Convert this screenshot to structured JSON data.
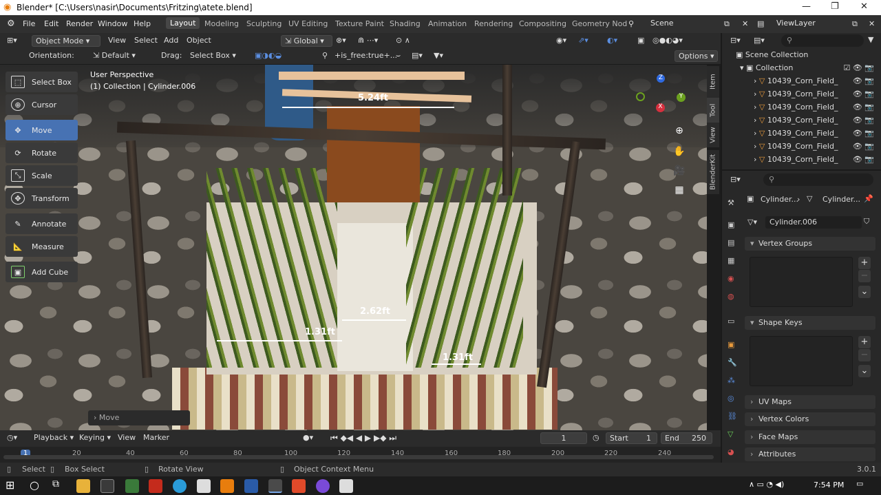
{
  "window": {
    "title": "Blender* [C:\\Users\\nasir\\Documents\\Fritzing\\atete.blend]",
    "min": "—",
    "max": "❐",
    "close": "✕"
  },
  "menu": {
    "file": "File",
    "edit": "Edit",
    "render": "Render",
    "window": "Window",
    "help": "Help"
  },
  "workspaces": [
    "Layout",
    "Modeling",
    "Sculpting",
    "UV Editing",
    "Texture Paint",
    "Shading",
    "Animation",
    "Rendering",
    "Compositing",
    "Geometry Nod"
  ],
  "scene": "Scene",
  "view_layer": "ViewLayer",
  "header": {
    "mode": "Object Mode",
    "view": "View",
    "select": "Select",
    "add": "Add",
    "object": "Object",
    "transform_orientation": "Global",
    "orientation_label": "Orientation:",
    "orientation_value": "Default",
    "drag_label": "Drag:",
    "drag_value": "Select Box",
    "filter": "+is_free:true+...",
    "options": "Options"
  },
  "viewport": {
    "perspective": "User Perspective",
    "collection_info": "(1) Collection | Cylinder.006",
    "last_op": "Move",
    "dims": [
      "5.24ft",
      "2.62ft",
      "1.31ft",
      "1.31ft"
    ]
  },
  "tools": [
    "Select Box",
    "Cursor",
    "Move",
    "Rotate",
    "Scale",
    "Transform",
    "Annotate",
    "Measure",
    "Add Cube"
  ],
  "side_tabs": [
    "Item",
    "Tool",
    "View",
    "BlenderKit"
  ],
  "outliner": {
    "scene_collection": "Scene Collection",
    "collection": "Collection",
    "items": [
      "10439_Corn_Field_",
      "10439_Corn_Field_",
      "10439_Corn_Field_",
      "10439_Corn_Field_",
      "10439_Corn_Field_",
      "10439_Corn_Field_",
      "10439_Corn_Field_"
    ]
  },
  "props": {
    "breadcrumb1": "Cylinder...",
    "breadcrumb2": "Cylinder...",
    "mesh_name": "Cylinder.006",
    "vertex_groups": "Vertex Groups",
    "shape_keys": "Shape Keys",
    "uv_maps": "UV Maps",
    "vertex_colors": "Vertex Colors",
    "face_maps": "Face Maps",
    "attributes": "Attributes"
  },
  "timeline": {
    "playback": "Playback",
    "keying": "Keying",
    "view": "View",
    "marker": "Marker",
    "current_frame": "1",
    "start_label": "Start",
    "start": "1",
    "end_label": "End",
    "end": "250",
    "ticks": [
      "1",
      "20",
      "40",
      "60",
      "80",
      "100",
      "120",
      "140",
      "160",
      "180",
      "200",
      "220",
      "240"
    ]
  },
  "status": {
    "select": "Select",
    "box_select": "Box Select",
    "rotate_view": "Rotate View",
    "context_menu": "Object Context Menu",
    "version": "3.0.1"
  },
  "taskbar": {
    "time": "7:54 PM"
  }
}
